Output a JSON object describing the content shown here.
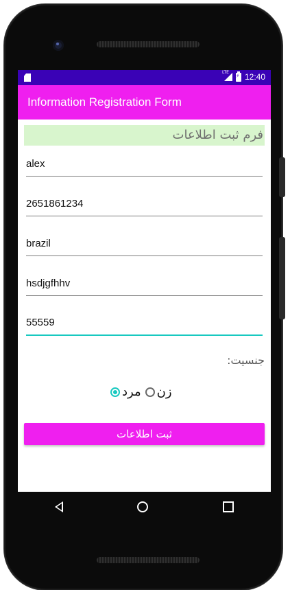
{
  "status_bar": {
    "time": "12:40",
    "signal_label": "LTE",
    "icons": [
      "sd-card-icon",
      "signal-icon",
      "battery-icon"
    ]
  },
  "app_bar": {
    "title": "Information Registration Form"
  },
  "form": {
    "header": "فرم ثبت اطلاعات",
    "fields": [
      {
        "value": "alex"
      },
      {
        "value": "2651861234"
      },
      {
        "value": "brazil"
      },
      {
        "value": "hsdjgfhhv"
      },
      {
        "value": "55559"
      }
    ],
    "gender_label": "جنسیت:",
    "gender_options": {
      "male": "مرد",
      "female": "زن",
      "selected": "male"
    },
    "submit_label": "ثبت اطلاعات"
  },
  "colors": {
    "status_bar": "#3a02b6",
    "accent": "#ef1fef",
    "focus": "#18c9c0",
    "header_bg": "#d8f5cd"
  },
  "nav_bar": {
    "icons": [
      "back-icon",
      "home-icon",
      "recents-icon"
    ]
  }
}
